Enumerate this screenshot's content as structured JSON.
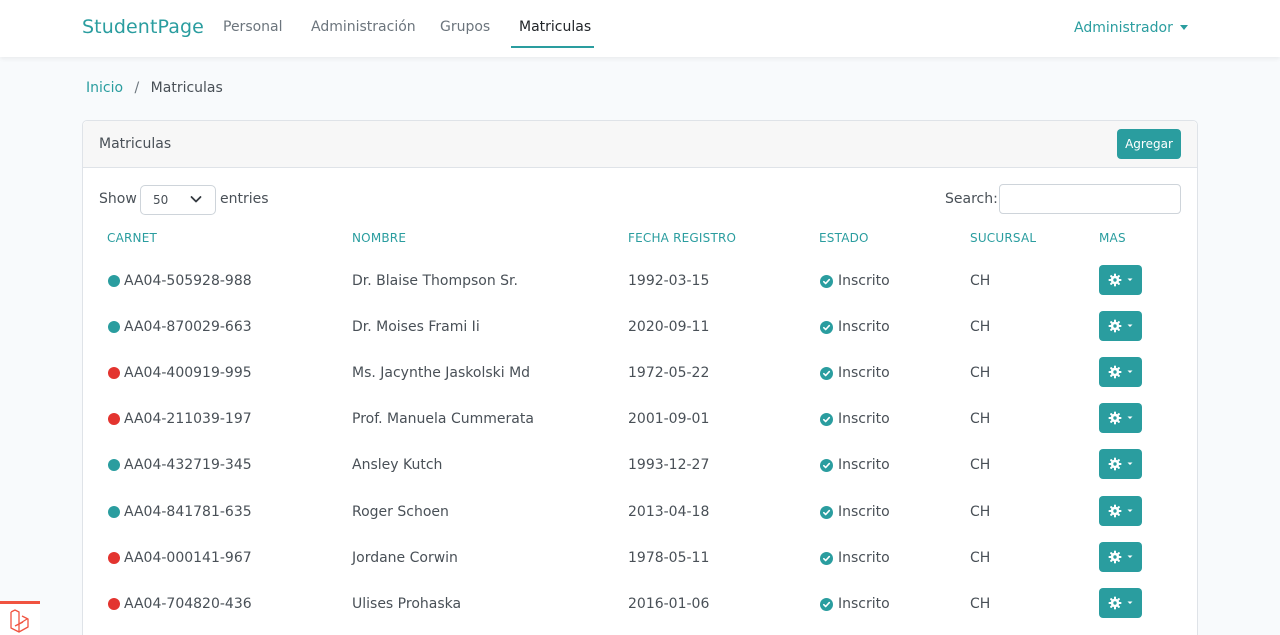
{
  "navbar": {
    "brand": "StudentPage",
    "links": [
      "Personal",
      "Administración",
      "Grupos",
      "Matriculas"
    ],
    "active_index": 3,
    "user_menu": "Administrador"
  },
  "breadcrumb": {
    "home": "Inicio",
    "separator": "/",
    "current": "Matriculas"
  },
  "card": {
    "title": "Matriculas",
    "add_button": "Agregar",
    "show_label": "Show",
    "entries_select": "50",
    "entries_label": "entries",
    "search_label": "Search:",
    "search_value": ""
  },
  "table": {
    "headers": [
      "CARNET",
      "NOMBRE",
      "FECHA REGISTRO",
      "ESTADO",
      "SUCURSAL",
      "MAS"
    ],
    "rows": [
      {
        "carnet": "AA04-505928-988",
        "nombre": "Dr. Blaise Thompson Sr.",
        "fecha": "1992-03-15",
        "estado": "Inscrito",
        "sucursal": "CH",
        "status": "teal"
      },
      {
        "carnet": "AA04-870029-663",
        "nombre": "Dr. Moises Frami Ii",
        "fecha": "2020-09-11",
        "estado": "Inscrito",
        "sucursal": "CH",
        "status": "teal"
      },
      {
        "carnet": "AA04-400919-995",
        "nombre": "Ms. Jacynthe Jaskolski Md",
        "fecha": "1972-05-22",
        "estado": "Inscrito",
        "sucursal": "CH",
        "status": "red"
      },
      {
        "carnet": "AA04-211039-197",
        "nombre": "Prof. Manuela Cummerata",
        "fecha": "2001-09-01",
        "estado": "Inscrito",
        "sucursal": "CH",
        "status": "red"
      },
      {
        "carnet": "AA04-432719-345",
        "nombre": "Ansley Kutch",
        "fecha": "1993-12-27",
        "estado": "Inscrito",
        "sucursal": "CH",
        "status": "teal"
      },
      {
        "carnet": "AA04-841781-635",
        "nombre": "Roger Schoen",
        "fecha": "2013-04-18",
        "estado": "Inscrito",
        "sucursal": "CH",
        "status": "teal"
      },
      {
        "carnet": "AA04-000141-967",
        "nombre": "Jordane Corwin",
        "fecha": "1978-05-11",
        "estado": "Inscrito",
        "sucursal": "CH",
        "status": "red"
      },
      {
        "carnet": "AA04-704820-436",
        "nombre": "Ulises Prohaska",
        "fecha": "2016-01-06",
        "estado": "Inscrito",
        "sucursal": "CH",
        "status": "red"
      }
    ]
  },
  "colors": {
    "accent": "#2a9d9f",
    "teal_dot": "#2a9d9f",
    "red_dot": "#e3342f",
    "laravel": "#f05340"
  },
  "icons": [
    "chevron-down-icon",
    "check-circle-icon",
    "gear-icon",
    "caret-down-icon",
    "laravel-icon"
  ]
}
